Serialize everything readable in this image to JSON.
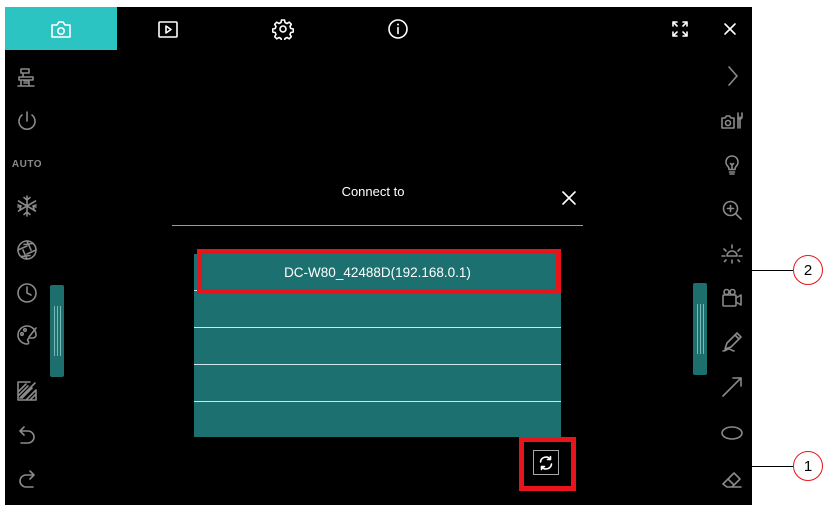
{
  "dialog": {
    "title": "Connect to",
    "devices": [
      "DC-W80_42488D(192.168.0.1)",
      "",
      "",
      "",
      ""
    ]
  },
  "left_toolbar": {
    "auto_label": "AUTO",
    "icons": [
      "visualizer-icon",
      "power-icon",
      "auto-icon",
      "freeze-icon",
      "aperture-icon",
      "timer-icon",
      "palette-icon",
      "annotate-icon",
      "undo-icon",
      "redo-icon"
    ]
  },
  "right_toolbar": {
    "icons": [
      "collapse-arrow-icon",
      "camera-settings-icon",
      "lamp-icon",
      "zoom-icon",
      "brightness-icon",
      "record-icon",
      "pen-icon",
      "line-icon",
      "ellipse-icon",
      "eraser-icon"
    ]
  },
  "top_tabs": [
    "camera-icon",
    "playback-icon",
    "settings-icon",
    "info-icon"
  ],
  "callouts": {
    "first": "1",
    "second": "2"
  },
  "colors": {
    "accent": "#2bc4c2",
    "list_bg": "#1d7070",
    "highlight": "#e8141c"
  }
}
